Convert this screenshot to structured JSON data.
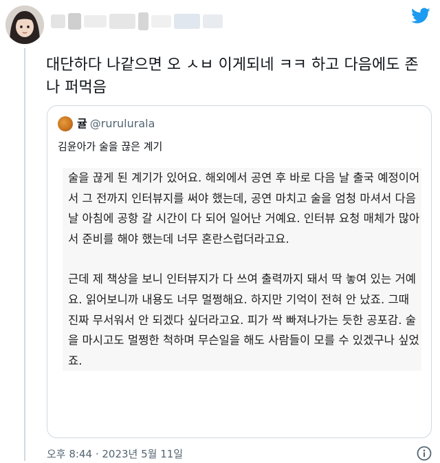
{
  "tweet": {
    "text": "대단하다 나같으면 오 ㅅㅂ 이게되네 ㅋㅋ 하고 다음에도 존나 퍼먹음"
  },
  "quoted": {
    "author_name": "귤",
    "handle": "@rurulurala",
    "text": "김윤아가 술을 끊은 계기",
    "image_paragraphs": [
      "술을 끊게 된 계기가 있어요. 해외에서 공연 후 바로 다음 날 출국 예정이어서 그 전까지 인터뷰지를 써야 했는데, 공연 마치고 술을 엄청 마셔서 다음날 아침에 공항 갈 시간이 다 되어 일어난 거예요. 인터뷰 요청 매체가 많아서 준비를 해야 했는데 너무 혼란스럽더라고요.",
      "근데 제 책상을 보니 인터뷰지가 다 쓰여 출력까지 돼서 딱 놓여 있는 거예요. 읽어보니까 내용도 너무 멀쩡해요. 하지만 기억이 전혀 안 났죠. 그때 진짜 무서워서 안 되겠다 싶더라고요. 피가 싹 빠져나가는 듯한 공포감. 술을 마시고도 멀쩡한 척하며 무슨일을 해도 사람들이 모를 수 있겠구나 싶었죠."
    ]
  },
  "footer": {
    "timestamp": "오후 8:44 · 2023년 5월 11일"
  },
  "icons": {
    "brand": "twitter-bird-icon",
    "info": "info-icon"
  },
  "colors": {
    "twitter_blue": "#1d9bf0",
    "secondary_text": "#536471",
    "border": "#cfd9de"
  }
}
